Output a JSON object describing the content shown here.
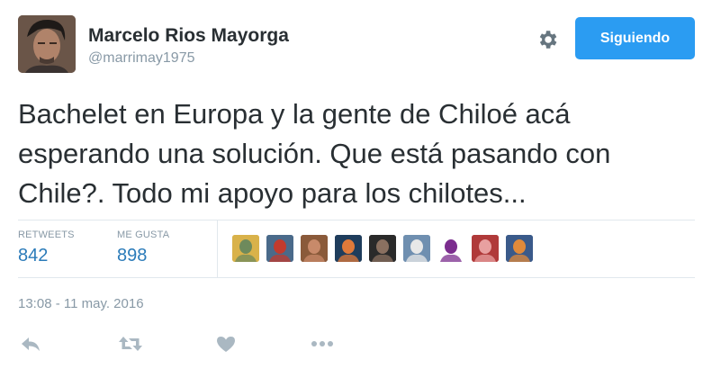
{
  "author": {
    "fullname": "Marcelo Rios Mayorga",
    "screen_name": "@marrimay1975"
  },
  "follow_button": {
    "label": "Siguiendo",
    "color": "#2b9cf2"
  },
  "settings_icon": "gear-icon",
  "tweet": {
    "text": "Bachelet en Europa y la gente de Chiloé acá esperando una solución. Que está pasando con Chile?. Todo mi apoyo para los chilotes..."
  },
  "stats": {
    "retweets_label": "RETWEETS",
    "retweets_count": "842",
    "likes_label": "ME GUSTA",
    "likes_count": "898"
  },
  "likers": [
    {
      "name": "liker-1",
      "bg": "#d9b24a",
      "fg": "#6e8a5c"
    },
    {
      "name": "liker-2",
      "bg": "#4a6a8a",
      "fg": "#c23b2e"
    },
    {
      "name": "liker-3",
      "bg": "#8a5a3a",
      "fg": "#c88a6a"
    },
    {
      "name": "liker-4",
      "bg": "#1f3d5c",
      "fg": "#e07a3a"
    },
    {
      "name": "liker-5",
      "bg": "#2a2a2a",
      "fg": "#8a7060"
    },
    {
      "name": "liker-6",
      "bg": "#6f8fb0",
      "fg": "#e8e8e8"
    },
    {
      "name": "liker-7",
      "bg": "#ffffff",
      "fg": "#7b2d8e"
    },
    {
      "name": "liker-8",
      "bg": "#b03a3a",
      "fg": "#e8a0a0"
    },
    {
      "name": "liker-9",
      "bg": "#3a5a8a",
      "fg": "#e08a3a"
    }
  ],
  "timestamp": "13:08 - 11 may. 2016",
  "actions": [
    "reply-icon",
    "retweet-icon",
    "like-icon",
    "more-icon"
  ],
  "colors": {
    "link": "#2b7bb9",
    "muted": "#8899a6",
    "action": "#aab8c2"
  }
}
